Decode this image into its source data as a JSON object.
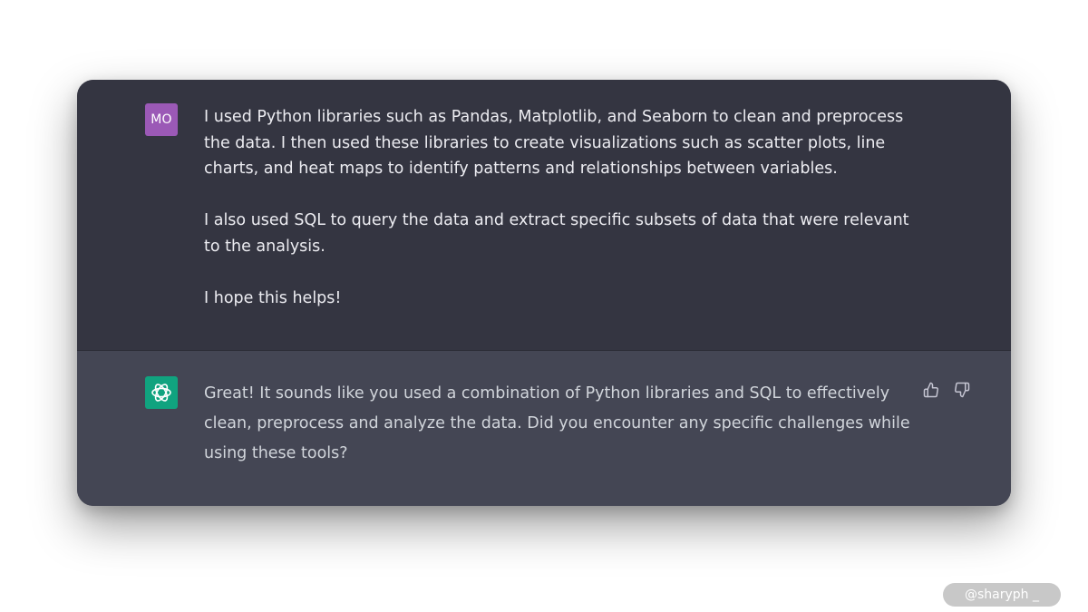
{
  "user_message": {
    "avatar_initials": "MO",
    "paragraphs": [
      "I used Python libraries such as Pandas, Matplotlib, and Seaborn to clean and preprocess the data. I then used these libraries to create visualizations such as scatter plots, line charts, and heat maps to identify patterns and relationships between variables.",
      "I also used SQL to query the data and extract specific subsets of data that were relevant to the analysis.",
      "I hope this helps!"
    ]
  },
  "assistant_message": {
    "avatar_icon": "openai-logo-icon",
    "text": "Great! It sounds like you used a combination of Python libraries and SQL to effectively clean, preprocess and analyze the data. Did you encounter any specific challenges while using these tools?",
    "feedback": {
      "thumbs_up_icon": "thumbs-up-icon",
      "thumbs_down_icon": "thumbs-down-icon"
    }
  },
  "watermark": "@sharyph _",
  "colors": {
    "user_bg": "#343541",
    "assistant_bg": "#444654",
    "user_avatar": "#9b59b6",
    "assistant_avatar": "#10a37f"
  }
}
